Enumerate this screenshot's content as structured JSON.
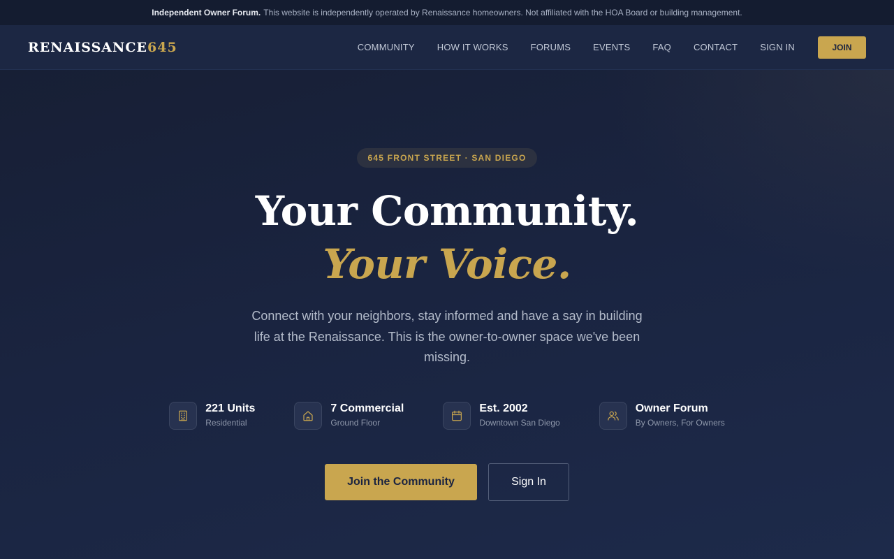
{
  "notice": {
    "bold": "Independent Owner Forum.",
    "text": "This website is independently operated by Renaissance homeowners. Not affiliated with the HOA Board or building management."
  },
  "brand": {
    "name": "RENAISSANCE",
    "number": "645"
  },
  "nav": {
    "items": [
      {
        "label": "COMMUNITY"
      },
      {
        "label": "HOW IT WORKS"
      },
      {
        "label": "FORUMS"
      },
      {
        "label": "EVENTS"
      },
      {
        "label": "FAQ"
      },
      {
        "label": "CONTACT"
      },
      {
        "label": "SIGN IN"
      }
    ],
    "join_label": "JOIN"
  },
  "hero": {
    "badge": "645 FRONT STREET · SAN DIEGO",
    "title_line1": "Your Community.",
    "title_line2": "Your Voice.",
    "lead": "Connect with your neighbors, stay informed and have a say in building life at the Renaissance. This is the owner-to-owner space we've been missing.",
    "stats": [
      {
        "icon": "building-icon",
        "title": "221 Units",
        "sub": "Residential"
      },
      {
        "icon": "home-icon",
        "title": "7 Commercial",
        "sub": "Ground Floor"
      },
      {
        "icon": "calendar-icon",
        "title": "Est. 2002",
        "sub": "Downtown San Diego"
      },
      {
        "icon": "users-icon",
        "title": "Owner Forum",
        "sub": "By Owners, For Owners"
      }
    ],
    "primary_cta": "Join the Community",
    "secondary_cta": "Sign In"
  },
  "colors": {
    "accent": "#c9a64f",
    "background": "#1a2540",
    "topbar": "#141c30"
  }
}
